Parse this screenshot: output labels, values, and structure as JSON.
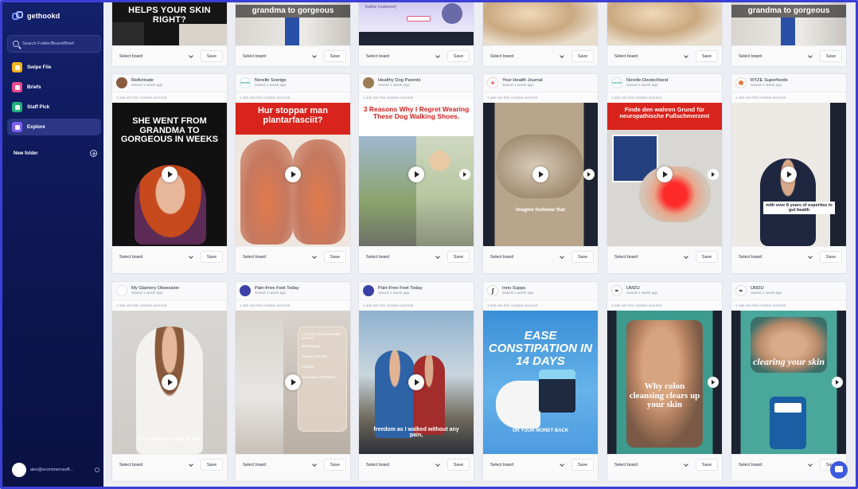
{
  "app": {
    "name": "gethookd"
  },
  "sidebar": {
    "search_placeholder": "Search Folder/Board/Brief",
    "items": [
      {
        "label": "Swipe File",
        "icon": "swipe-file-icon",
        "color": "#f5b21b",
        "active": false
      },
      {
        "label": "Briefs",
        "icon": "briefs-icon",
        "color": "#e6498f",
        "active": false
      },
      {
        "label": "Staff Pick",
        "icon": "staff-pick-icon",
        "color": "#22b07d",
        "active": false
      },
      {
        "label": "Explore",
        "icon": "explore-icon",
        "color": "#7b5cf5",
        "active": true
      }
    ],
    "new_folder_label": "New folder",
    "user_email": "alex@ecommerceoff..."
  },
  "card_common": {
    "select_board": "Select board",
    "save": "Save",
    "usage": "1 ads use this creative and text"
  },
  "row0": [
    {
      "text": "HELPS YOUR SKIN RIGHT?"
    },
    {
      "text": "grandma to gorgeous"
    },
    {
      "text": "Kathie (customer)"
    },
    {
      "text": ""
    },
    {
      "text": ""
    },
    {
      "text": "grandma to gorgeous"
    }
  ],
  "row1": [
    {
      "brand": "ReActivate",
      "saved": "Saved 1 week ago",
      "headline": "SHE WENT FROM GRANDMA TO GORGEOUS IN WEEKS",
      "accent": "#c0241f"
    },
    {
      "brand": "Norelle Sverige",
      "saved": "Saved 1 week ago",
      "headline": "Hur stoppar man plantarfasciit?",
      "accent": "#d8241c"
    },
    {
      "brand": "Healthy Dog Parents",
      "saved": "Saved 1 week ago",
      "headline": "3 Reasons Why I Regret Wearing These Dog Walking Shoes.",
      "accent": "#d31f1f"
    },
    {
      "brand": "Your Health Journal",
      "saved": "Saved 1 week ago",
      "caption": "Imagine footwear that",
      "accent": "#b08a66"
    },
    {
      "brand": "Norelle Deutschland",
      "saved": "Saved 1 week ago",
      "headline": "Finde den wahren Grund für neuropathische Fußschmerzen!",
      "accent": "#d8241c"
    },
    {
      "brand": "RYZE Superfoods",
      "saved": "Saved 1 week ago",
      "caption": "with over 8 years of expertise in gut health",
      "accent": "#2a3145"
    }
  ],
  "row2": [
    {
      "brand": "My Glamory Obsession",
      "saved": "Saved 1 week ago",
      "caption": "it's extremely easy to use"
    },
    {
      "brand": "Pain-Free Feet Today",
      "saved": "Saved 1 week ago",
      "list": [
        "Clinically recommended to treat:",
        "Neuropathy",
        "Plantar Fasciitis",
        "Arthritis",
        "Circulation Problems"
      ]
    },
    {
      "brand": "Pain-Free Feet Today",
      "saved": "Saved 1 week ago",
      "caption": "freedom as I walked without any pain,"
    },
    {
      "brand": "Inno Supps",
      "saved": "Saved 1 week ago",
      "headline": "EASE CONSTIPATION IN 14 DAYS",
      "footer": "OR YOUR MONEY BACK"
    },
    {
      "brand": "UMZU",
      "saved": "Saved 1 week ago",
      "headline": "Why colon cleansing clears up your skin"
    },
    {
      "brand": "UMZU",
      "saved": "Saved 1 week ago",
      "headline": "clearing your skin"
    }
  ]
}
